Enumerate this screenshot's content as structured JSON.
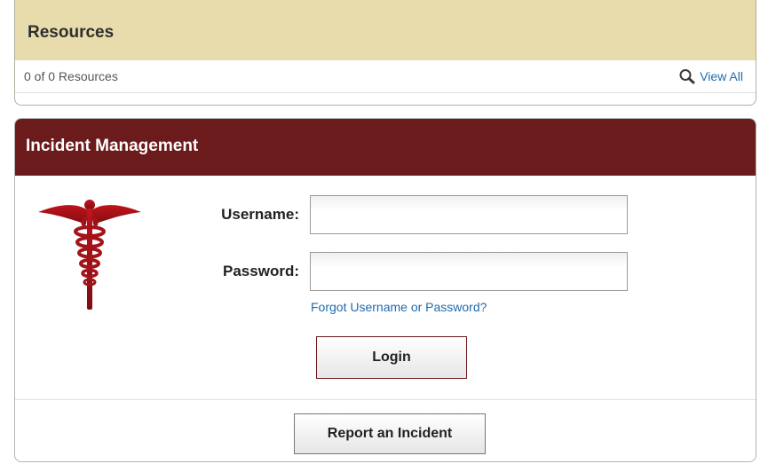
{
  "resources": {
    "title": "Resources",
    "count_text": "0 of 0 Resources",
    "view_all_label": "View All"
  },
  "incident": {
    "title": "Incident Management",
    "username_label": "Username:",
    "password_label": "Password:",
    "username_value": "",
    "password_value": "",
    "forgot_link": "Forgot Username or Password?",
    "login_button": "Login",
    "report_button": "Report an Incident"
  },
  "colors": {
    "resources_header_bg": "#e8dcac",
    "incident_header_bg": "#6b1b1c",
    "link": "#1f6bb0",
    "caduceus": "#a3131a"
  },
  "icons": {
    "view_all": "magnifier-icon",
    "logo": "caduceus-icon"
  }
}
